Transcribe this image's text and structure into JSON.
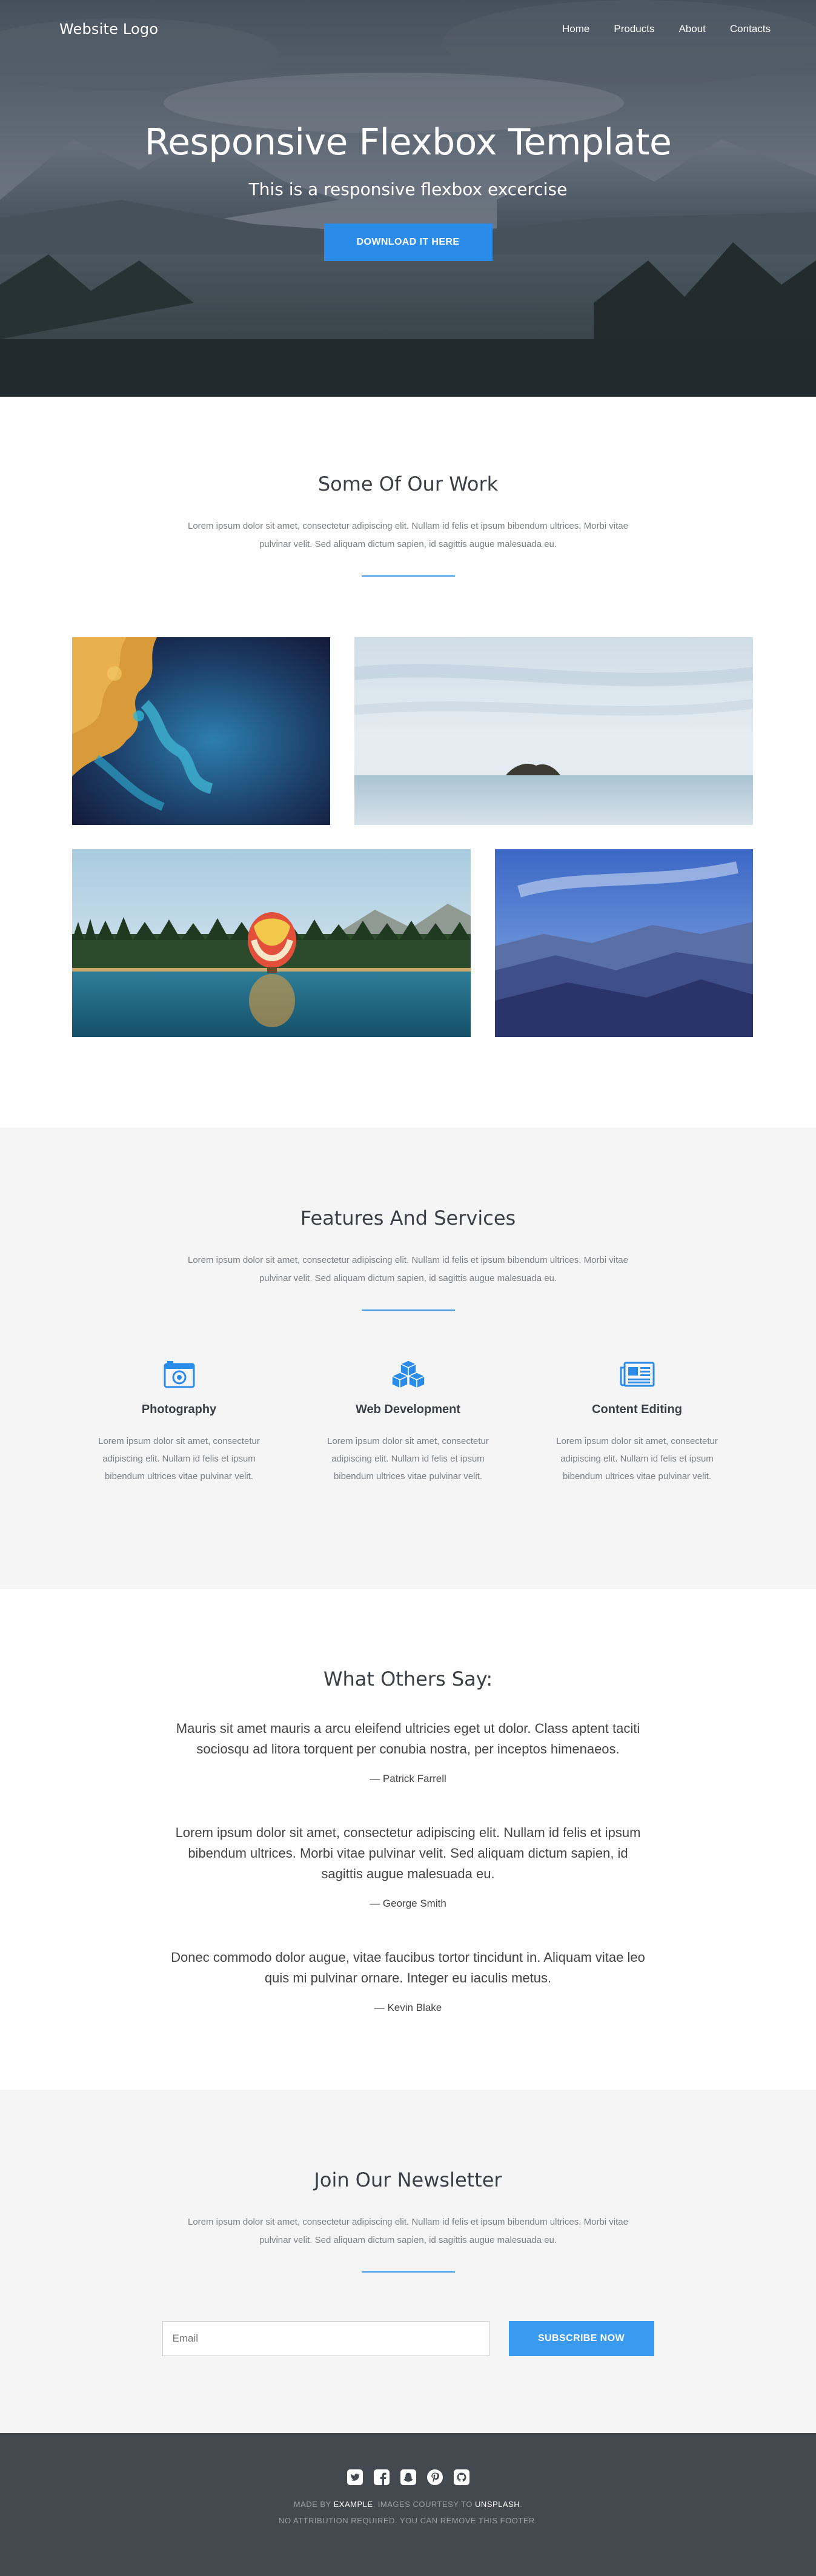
{
  "header": {
    "logo": "Website Logo",
    "nav": [
      "Home",
      "Products",
      "About",
      "Contacts"
    ]
  },
  "hero": {
    "title": "Responsive Flexbox Template",
    "subtitle": "This is a responsive flexbox excercise",
    "button": "DOWNLOAD IT HERE"
  },
  "work": {
    "title": "Some Of Our Work",
    "text": "Lorem ipsum dolor sit amet, consectetur adipiscing elit. Nullam id felis et ipsum bibendum ultrices. Morbi vitae pulvinar velit. Sed aliquam dictum sapien, id sagittis augue malesuada eu.",
    "gallery": [
      "coastline-aerial",
      "island-sea",
      "hot-air-balloon-lake",
      "mountain-range"
    ]
  },
  "features": {
    "title": "Features And Services",
    "text": "Lorem ipsum dolor sit amet, consectetur adipiscing elit. Nullam id felis et ipsum bibendum ultrices. Morbi vitae pulvinar velit. Sed aliquam dictum sapien, id sagittis augue malesuada eu.",
    "items": [
      {
        "icon": "camera-icon",
        "title": "Photography",
        "text": "Lorem ipsum dolor sit amet, consectetur adipiscing elit. Nullam id felis et ipsum bibendum ultrices vitae pulvinar velit."
      },
      {
        "icon": "cubes-icon",
        "title": "Web Development",
        "text": "Lorem ipsum dolor sit amet, consectetur adipiscing elit. Nullam id felis et ipsum bibendum ultrices vitae pulvinar velit."
      },
      {
        "icon": "newspaper-icon",
        "title": "Content Editing",
        "text": "Lorem ipsum dolor sit amet, consectetur adipiscing elit. Nullam id felis et ipsum bibendum ultrices vitae pulvinar velit."
      }
    ]
  },
  "testimonials": {
    "title": "What Others Say:",
    "quotes": [
      {
        "text": "Mauris sit amet mauris a arcu eleifend ultricies eget ut dolor. Class aptent taciti sociosqu ad litora torquent per conubia nostra, per inceptos himenaeos.",
        "author": "— Patrick Farrell"
      },
      {
        "text": "Lorem ipsum dolor sit amet, consectetur adipiscing elit. Nullam id felis et ipsum bibendum ultrices. Morbi vitae pulvinar velit. Sed aliquam dictum sapien, id sagittis augue malesuada eu.",
        "author": "— George Smith"
      },
      {
        "text": "Donec commodo dolor augue, vitae faucibus tortor tincidunt in. Aliquam vitae leo quis mi pulvinar ornare. Integer eu iaculis metus.",
        "author": "— Kevin Blake"
      }
    ]
  },
  "newsletter": {
    "title": "Join Our Newsletter",
    "text": "Lorem ipsum dolor sit amet, consectetur adipiscing elit. Nullam id felis et ipsum bibendum ultrices. Morbi vitae pulvinar velit. Sed aliquam dictum sapien, id sagittis augue malesuada eu.",
    "email_placeholder": "Email",
    "button": "SUBSCRIBE NOW"
  },
  "footer": {
    "social": [
      "twitter-icon",
      "facebook-icon",
      "snapchat-icon",
      "pinterest-icon",
      "github-icon"
    ],
    "made_by_prefix": "MADE BY ",
    "made_by_link": "EXAMPLE",
    "images_prefix": ". IMAGES COURTESY TO ",
    "images_link": "UNSPLASH",
    "images_suffix": ".",
    "attribution": "NO ATTRIBUTION REQUIRED. YOU CAN REMOVE THIS FOOTER."
  },
  "colors": {
    "accent": "#2a8ce8",
    "footer_bg": "#44484f",
    "section_alt_bg": "#f5f5f5"
  }
}
